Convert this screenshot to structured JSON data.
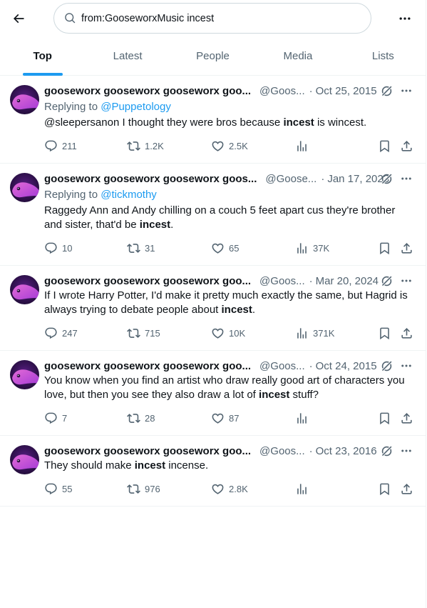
{
  "search": {
    "query": "from:GooseworxMusic incest"
  },
  "tabs": [
    {
      "label": "Top",
      "active": true
    },
    {
      "label": "Latest"
    },
    {
      "label": "People"
    },
    {
      "label": "Media"
    },
    {
      "label": "Lists"
    }
  ],
  "tweets": [
    {
      "name": "gooseworx gooseworx gooseworx goo...",
      "handle": "@Goos...",
      "date": "Oct 25, 2015",
      "reply_prefix": "Replying to",
      "reply_to": "@Puppetology",
      "text_before": "@sleepersanon I thought they were bros because ",
      "text_bold": "incest",
      "text_after": " is wincest.",
      "replies": "211",
      "reposts": "1.2K",
      "likes": "2.5K",
      "views": ""
    },
    {
      "name": "gooseworx gooseworx gooseworx goos...",
      "handle": "@Goose...",
      "date": "Jan 17, 2023",
      "reply_prefix": "Replying to",
      "reply_to": "@tickmothy",
      "text_before": "Raggedy Ann and Andy chilling on a couch 5 feet apart cus they're brother and sister, that'd be ",
      "text_bold": "incest",
      "text_after": ".",
      "replies": "10",
      "reposts": "31",
      "likes": "65",
      "views": "37K"
    },
    {
      "name": "gooseworx gooseworx gooseworx goo...",
      "handle": "@Goos...",
      "date": "Mar 20, 2024",
      "text_before": "If I wrote Harry Potter, I'd make it pretty much exactly the same, but Hagrid is always trying to debate people about ",
      "text_bold": "incest",
      "text_after": ".",
      "replies": "247",
      "reposts": "715",
      "likes": "10K",
      "views": "371K"
    },
    {
      "name": "gooseworx gooseworx gooseworx goo...",
      "handle": "@Goos...",
      "date": "Oct 24, 2015",
      "text_before": "You know when you find an artist who draw really good art of characters you love, but then you see they also draw a lot of ",
      "text_bold": "incest",
      "text_after": " stuff?",
      "replies": "7",
      "reposts": "28",
      "likes": "87",
      "views": ""
    },
    {
      "name": "gooseworx gooseworx gooseworx goo...",
      "handle": "@Goos...",
      "date": "Oct 23, 2016",
      "text_before": "They should make ",
      "text_bold": "incest",
      "text_after": " incense.",
      "replies": "55",
      "reposts": "976",
      "likes": "2.8K",
      "views": ""
    }
  ],
  "colors": {
    "accent": "#1d9bf0",
    "muted": "#536471",
    "text": "#0f1419"
  }
}
